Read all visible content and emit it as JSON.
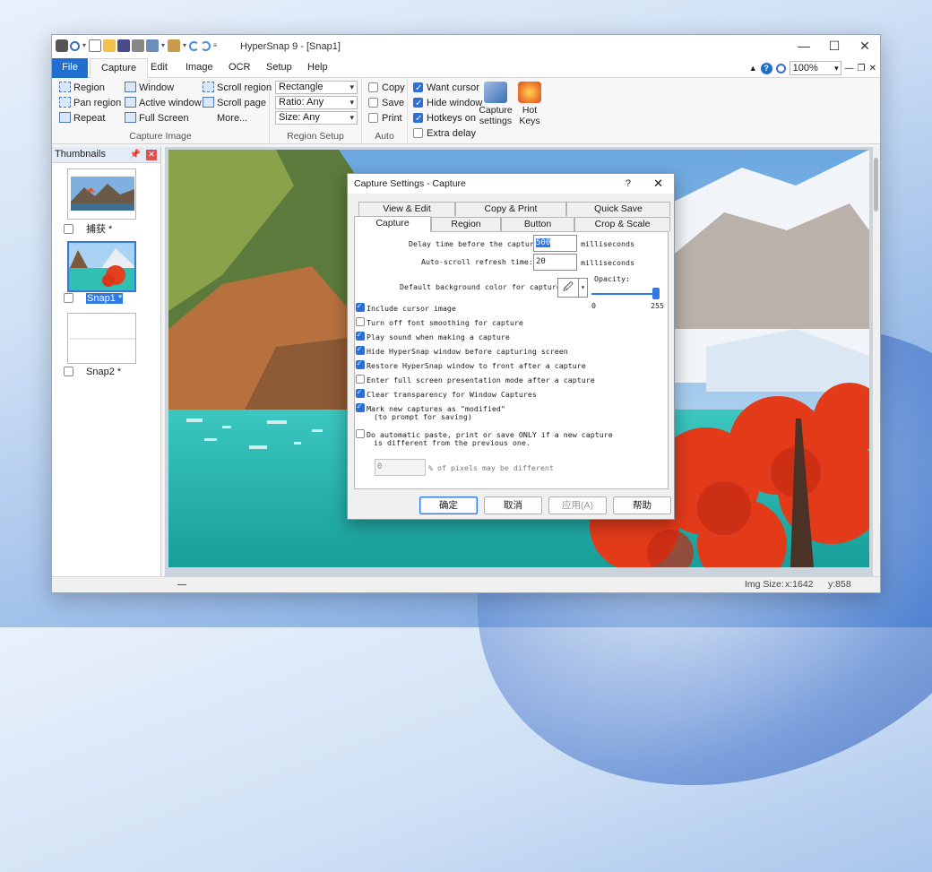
{
  "window": {
    "title": "HyperSnap 9 - [Snap1]",
    "minimize": "—",
    "maximize": "☐",
    "close": "✕"
  },
  "menu": {
    "tabs": [
      "File",
      "Capture",
      "Edit",
      "Image",
      "OCR",
      "Setup",
      "Help"
    ],
    "active": "Capture",
    "zoom": "100%"
  },
  "ribbon": {
    "capture_image": {
      "label": "Capture Image",
      "items": [
        "Region",
        "Pan region",
        "Repeat",
        "Window",
        "Active window",
        "Full Screen",
        "Scroll region",
        "Scroll page",
        "More..."
      ]
    },
    "region_setup": {
      "label": "Region Setup",
      "combos": [
        "Rectangle",
        "Ratio: Any",
        "Size: Any"
      ]
    },
    "auto": {
      "label": "Auto",
      "items": [
        {
          "label": "Copy",
          "checked": false
        },
        {
          "label": "Save",
          "checked": false
        },
        {
          "label": "Print",
          "checked": false
        }
      ]
    },
    "options": {
      "items": [
        {
          "label": "Want cursor",
          "checked": true
        },
        {
          "label": "Hide window",
          "checked": true
        },
        {
          "label": "Hotkeys on",
          "checked": true
        },
        {
          "label": "Extra delay",
          "checked": false
        }
      ],
      "capture_settings": "Capture settings",
      "hot_keys": "Hot Keys"
    }
  },
  "thumbnails": {
    "title": "Thumbnails",
    "items": [
      {
        "label": "捕获 *",
        "selected": false
      },
      {
        "label": "Snap1 *",
        "selected": true
      },
      {
        "label": "Snap2 *",
        "selected": false
      }
    ]
  },
  "status": {
    "img_size": "Img Size:",
    "x": "x:1642",
    "y": "y:858"
  },
  "colors": {
    "accent": "#2f7ae5",
    "file_tab": "#1f6fd0",
    "close_red": "#d9534f"
  },
  "dialog": {
    "title": "Capture Settings - Capture",
    "help": "?",
    "close": "✕",
    "tabs_row1": [
      "View & Edit",
      "Copy & Print",
      "Quick Save"
    ],
    "tabs_row2": [
      "Capture",
      "Region",
      "Button",
      "Crop & Scale"
    ],
    "active_tab": "Capture",
    "delay_label": "Delay time before the capture:",
    "delay_value": "500",
    "delay_unit": "milliseconds",
    "scroll_label": "Auto-scroll refresh time:",
    "scroll_value": "20",
    "scroll_unit": "milliseconds",
    "bg_label": "Default background color for captures:",
    "opacity_label": "Opacity:",
    "opacity_min": "0",
    "opacity_max": "255",
    "opacity_value": 255,
    "checkboxes": [
      {
        "label": "Include cursor image",
        "checked": true
      },
      {
        "label": "Turn off font smoothing for capture",
        "checked": false
      },
      {
        "label": "Play sound when making a capture",
        "checked": true
      },
      {
        "label": "Hide HyperSnap window before capturing screen",
        "checked": true
      },
      {
        "label": "Restore HyperSnap window to front after a capture",
        "checked": true
      },
      {
        "label": "Enter full screen presentation mode after a capture",
        "checked": false
      },
      {
        "label": "Clear transparency for Window Captures",
        "checked": true
      },
      {
        "label": "Mark new captures as \"modified\"",
        "label2": "(to prompt for saving)",
        "checked": true
      },
      {
        "label": "Do automatic paste, print or save ONLY if a new capture",
        "label2": "is different from the previous one.",
        "checked": false
      }
    ],
    "pixels_value": "0",
    "pixels_label": "% of pixels may be different",
    "buttons": [
      "确定",
      "取消",
      "应用(A)",
      "帮助"
    ]
  }
}
